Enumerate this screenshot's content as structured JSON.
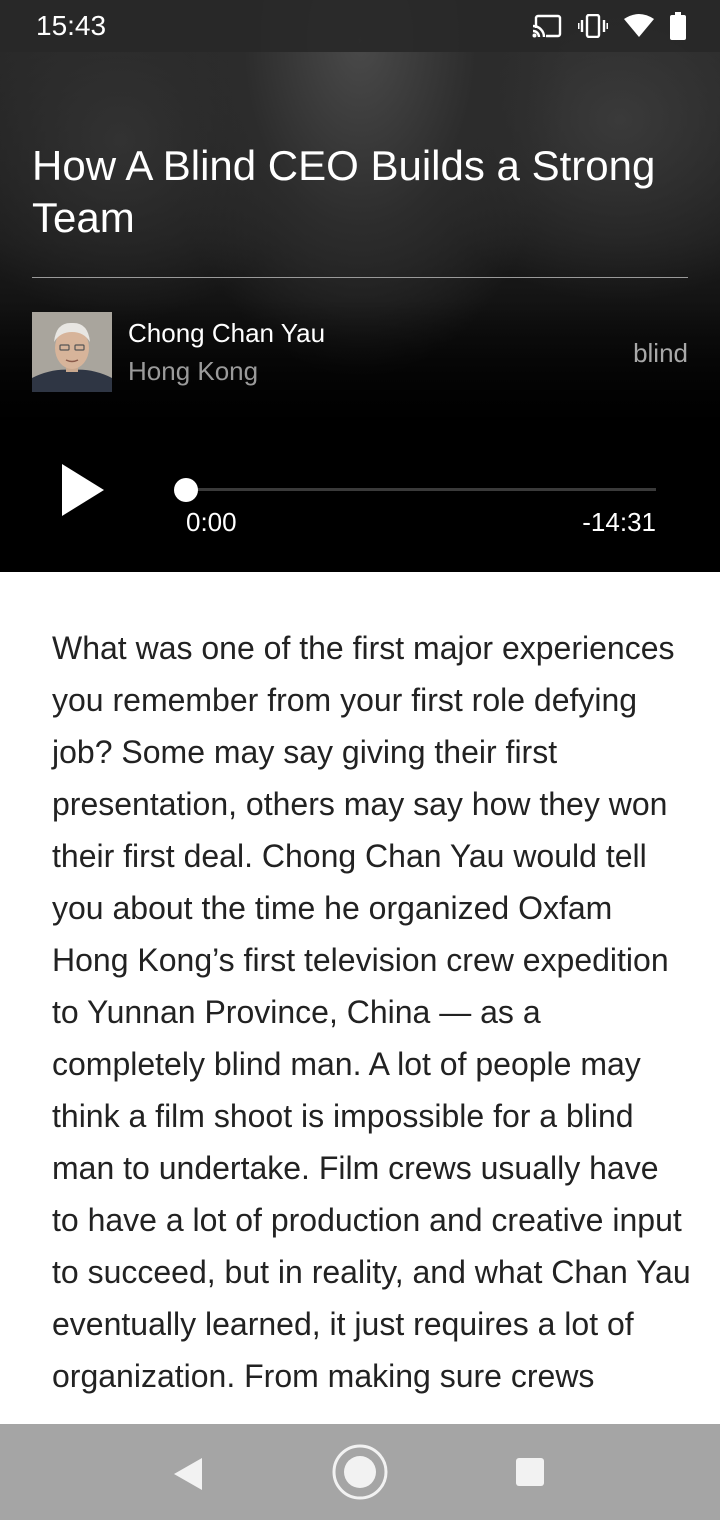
{
  "status_bar": {
    "time": "15:43",
    "icons": [
      "cast-icon",
      "vibrate-icon",
      "wifi-icon",
      "battery-icon"
    ]
  },
  "episode": {
    "title": "How A Blind CEO Builds a Strong Team",
    "author_name": "Chong Chan Yau",
    "author_location": "Hong Kong",
    "tag": "blind"
  },
  "player": {
    "current_time": "0:00",
    "remaining_time": "-14:31",
    "progress": 0
  },
  "article": {
    "text": "What was one of the first major experiences you remember from your first role defying job? Some may say giving their first presentation, others may say how they won their first deal. Chong Chan Yau would tell you about the time he organized Oxfam Hong Kong’s first television crew expedition to Yunnan Province, China — as a completely blind man. A lot of people may think a film shoot is impossible for a blind man to undertake. Film crews usually have to have a lot of production and creative input to succeed, but in reality, and what Chan Yau eventually learned, it just requires a lot of organization. From making sure crews"
  },
  "colors": {
    "hero_background": "#000000",
    "text_primary": "#ffffff",
    "text_secondary": "#9a9a9a",
    "article_text": "#222222"
  }
}
